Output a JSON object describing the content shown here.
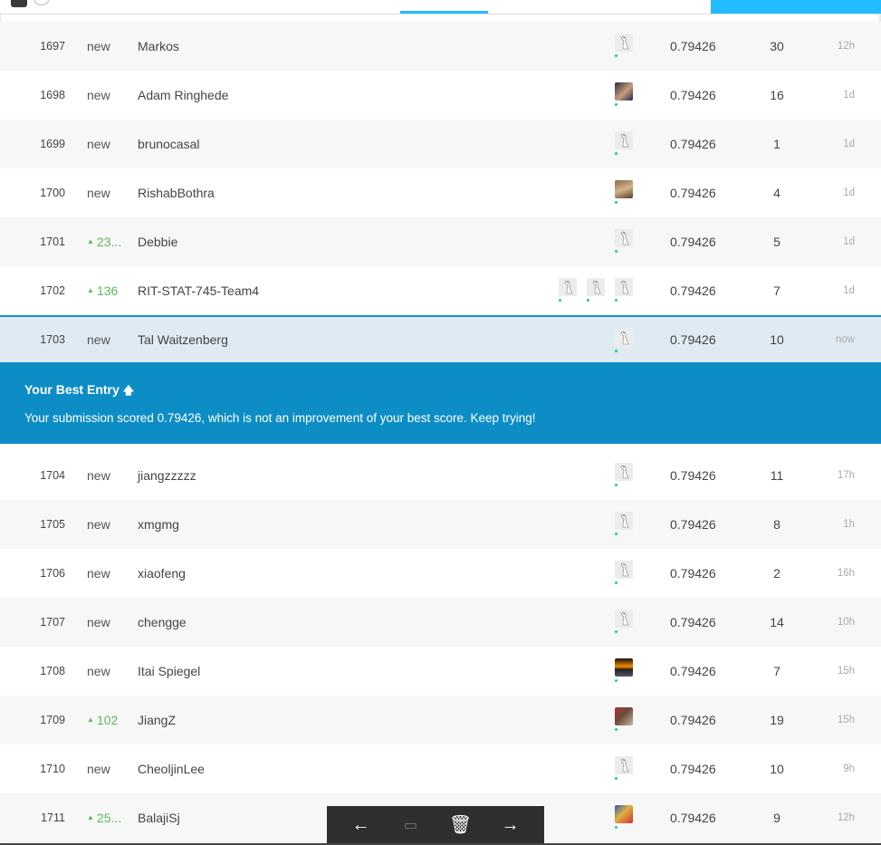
{
  "leaderboard": {
    "rows_before": [
      {
        "rank": "1697",
        "change": "new",
        "up": false,
        "team": "Markos",
        "avatars": [
          "goose"
        ],
        "score": "0.79426",
        "entries": "30",
        "last": "12h"
      },
      {
        "rank": "1698",
        "change": "new",
        "up": false,
        "team": "Adam Ringhede",
        "avatars": [
          "photo1"
        ],
        "score": "0.79426",
        "entries": "16",
        "last": "1d"
      },
      {
        "rank": "1699",
        "change": "new",
        "up": false,
        "team": "brunocasal",
        "avatars": [
          "goose"
        ],
        "score": "0.79426",
        "entries": "1",
        "last": "1d"
      },
      {
        "rank": "1700",
        "change": "new",
        "up": false,
        "team": "RishabBothra",
        "avatars": [
          "photo2"
        ],
        "score": "0.79426",
        "entries": "4",
        "last": "1d"
      },
      {
        "rank": "1701",
        "change": "23...",
        "up": true,
        "team": "Debbie",
        "avatars": [
          "goose"
        ],
        "score": "0.79426",
        "entries": "5",
        "last": "1d"
      },
      {
        "rank": "1702",
        "change": "136",
        "up": true,
        "team": "RIT-STAT-745-Team4",
        "avatars": [
          "goose",
          "goose",
          "goose"
        ],
        "score": "0.79426",
        "entries": "7",
        "last": "1d"
      }
    ],
    "my_row": {
      "rank": "1703",
      "change": "new",
      "up": false,
      "team": "Tal Waitzenberg",
      "avatars": [
        "goose"
      ],
      "score": "0.79426",
      "entries": "10",
      "last": "now"
    },
    "rows_after": [
      {
        "rank": "1704",
        "change": "new",
        "up": false,
        "team": "jiangzzzzz",
        "avatars": [
          "goose"
        ],
        "score": "0.79426",
        "entries": "11",
        "last": "17h"
      },
      {
        "rank": "1705",
        "change": "new",
        "up": false,
        "team": "xmgmg",
        "avatars": [
          "goose"
        ],
        "score": "0.79426",
        "entries": "8",
        "last": "1h"
      },
      {
        "rank": "1706",
        "change": "new",
        "up": false,
        "team": "xiaofeng",
        "avatars": [
          "goose"
        ],
        "score": "0.79426",
        "entries": "2",
        "last": "16h"
      },
      {
        "rank": "1707",
        "change": "new",
        "up": false,
        "team": "chengge",
        "avatars": [
          "goose"
        ],
        "score": "0.79426",
        "entries": "14",
        "last": "10h"
      },
      {
        "rank": "1708",
        "change": "new",
        "up": false,
        "team": "Itai Spiegel",
        "avatars": [
          "photo3"
        ],
        "score": "0.79426",
        "entries": "7",
        "last": "15h"
      },
      {
        "rank": "1709",
        "change": "102",
        "up": true,
        "team": "JiangZ",
        "avatars": [
          "photo4"
        ],
        "score": "0.79426",
        "entries": "19",
        "last": "15h"
      },
      {
        "rank": "1710",
        "change": "new",
        "up": false,
        "team": "CheoljinLee",
        "avatars": [
          "goose"
        ],
        "score": "0.79426",
        "entries": "10",
        "last": "9h"
      },
      {
        "rank": "1711",
        "change": "25...",
        "up": true,
        "team": "BalajiSj",
        "avatars": [
          "photo5"
        ],
        "score": "0.79426",
        "entries": "9",
        "last": "12h"
      }
    ]
  },
  "banner": {
    "title": "Your Best Entry",
    "title_icon": "arrow-up-icon",
    "message": "Your submission scored 0.79426, which is not an improvement of your best score. Keep trying!"
  },
  "toolbar": {
    "back_glyph": "←",
    "comment_glyph": "▭",
    "delete_glyph": "🗑",
    "forward_glyph": "→"
  },
  "colors": {
    "accent": "#20beff",
    "banner": "#0d8dc5",
    "up_change": "#5cb85c",
    "my_row": "#dfeaf2"
  }
}
